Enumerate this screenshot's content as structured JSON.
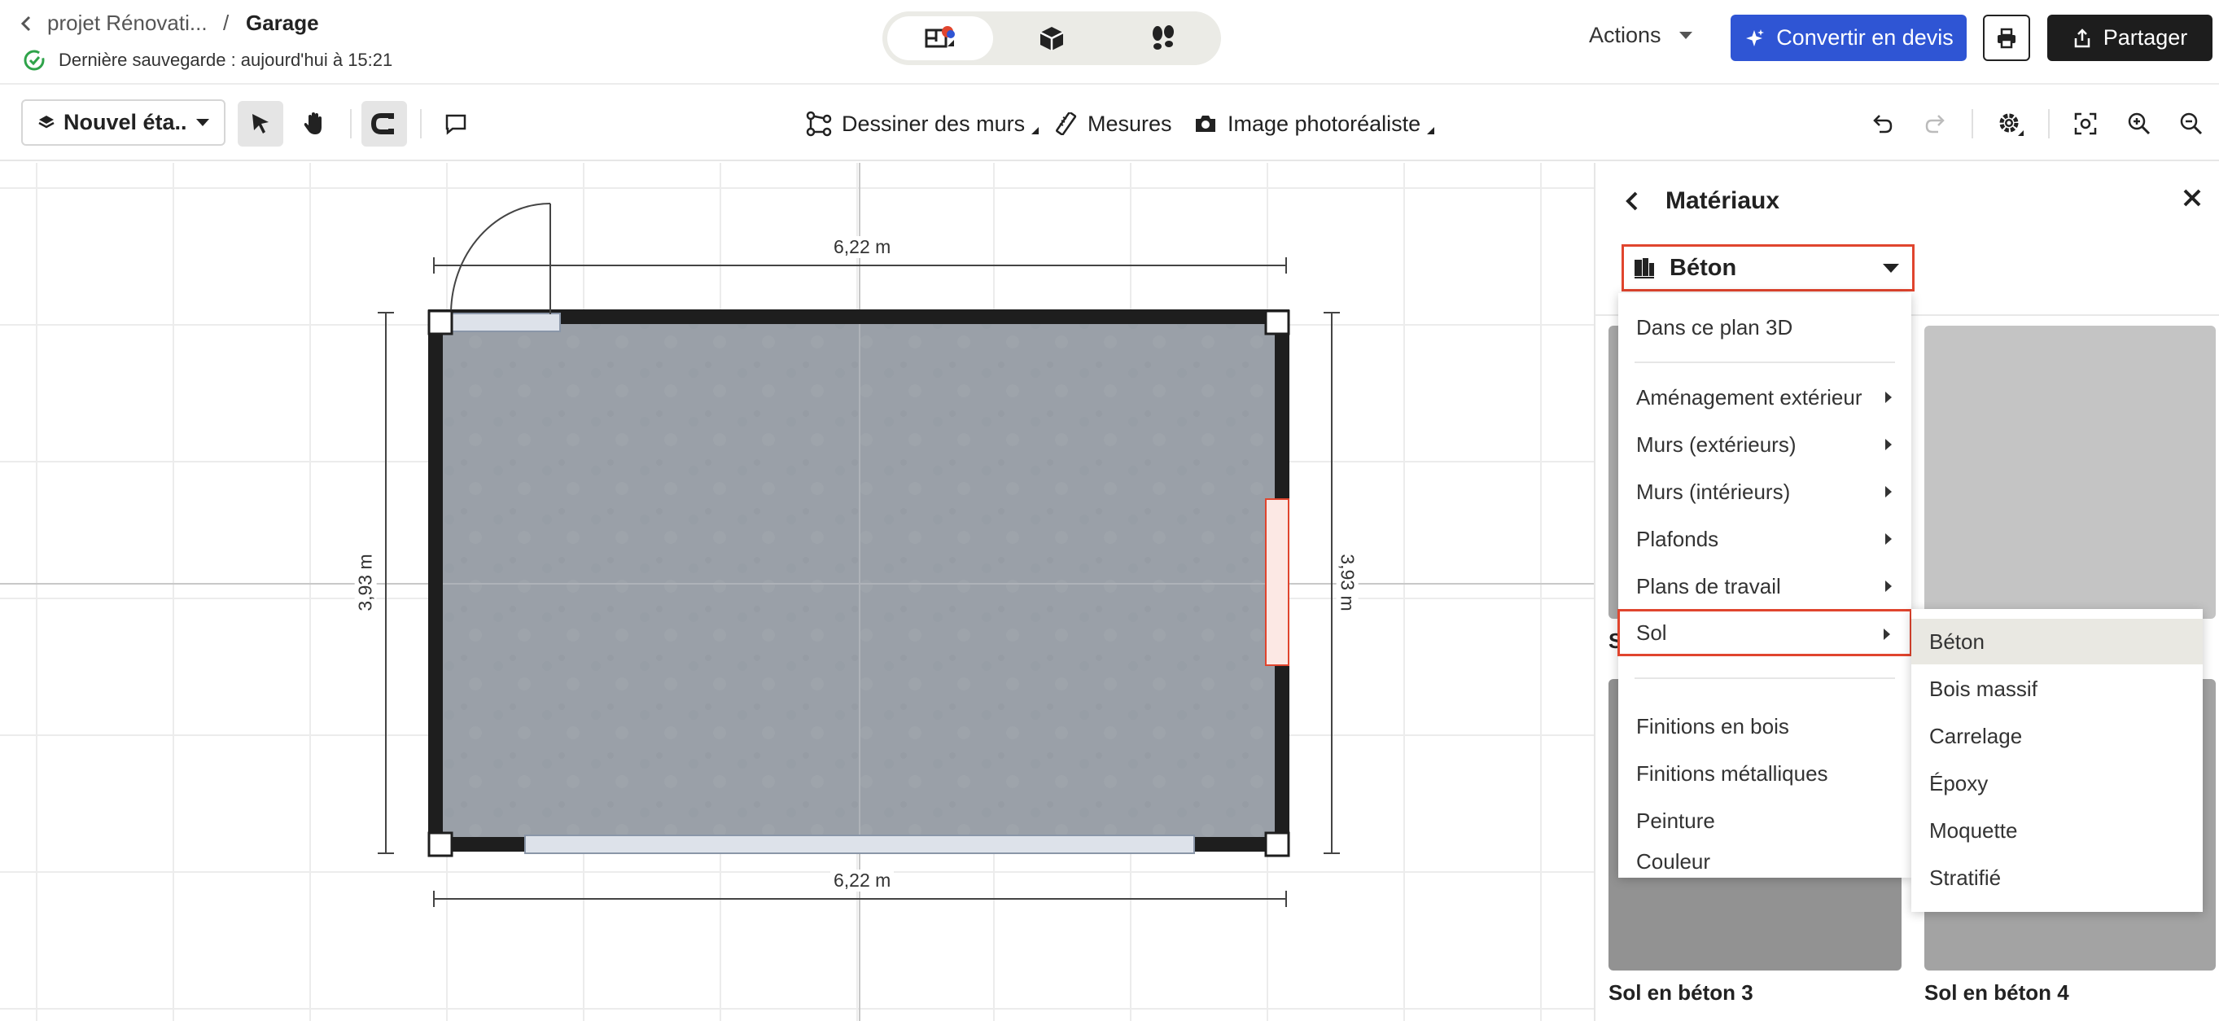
{
  "header": {
    "project_name": "projet Rénovati...",
    "separator": "/",
    "current_page": "Garage",
    "save_status": "Dernière sauvegarde : aujourd'hui à 15:21",
    "actions_label": "Actions",
    "convert_label": "Convertir en devis",
    "share_label": "Partager",
    "colors": {
      "primary": "#2f55d4",
      "dark": "#1d1d1d",
      "success": "#2fa34a"
    }
  },
  "toolbar": {
    "floor_label": "Nouvel éta...",
    "draw_walls_label": "Dessiner des murs",
    "measures_label": "Mesures",
    "photo_label": "Image photoréaliste"
  },
  "plan": {
    "dim_top": "6,22 m",
    "dim_bottom": "6,22 m",
    "dim_left": "3,93 m",
    "dim_right": "3,93 m"
  },
  "panel": {
    "title": "Matériaux",
    "selected_material": "Béton",
    "highlight_color": "#e0452e",
    "tiles": [
      {
        "name": "Sol en béton 3"
      },
      {
        "name": "Sol en béton 4"
      }
    ],
    "partial_tile_label": "S"
  },
  "category_menu": {
    "top_item": "Dans ce plan 3D",
    "items": [
      {
        "label": "Aménagement extérieur",
        "submenu": true
      },
      {
        "label": "Murs (extérieurs)",
        "submenu": true
      },
      {
        "label": "Murs (intérieurs)",
        "submenu": true
      },
      {
        "label": "Plafonds",
        "submenu": true
      },
      {
        "label": "Plans de travail",
        "submenu": true
      },
      {
        "label": "Sol",
        "submenu": true
      },
      {
        "label": "Finitions en bois",
        "submenu": false
      },
      {
        "label": "Finitions métalliques",
        "submenu": false
      },
      {
        "label": "Peinture",
        "submenu": false
      },
      {
        "label": "Couleur",
        "submenu": false
      }
    ]
  },
  "sol_submenu": {
    "items": [
      "Béton",
      "Bois massif",
      "Carrelage",
      "Époxy",
      "Moquette",
      "Stratifié"
    ]
  }
}
